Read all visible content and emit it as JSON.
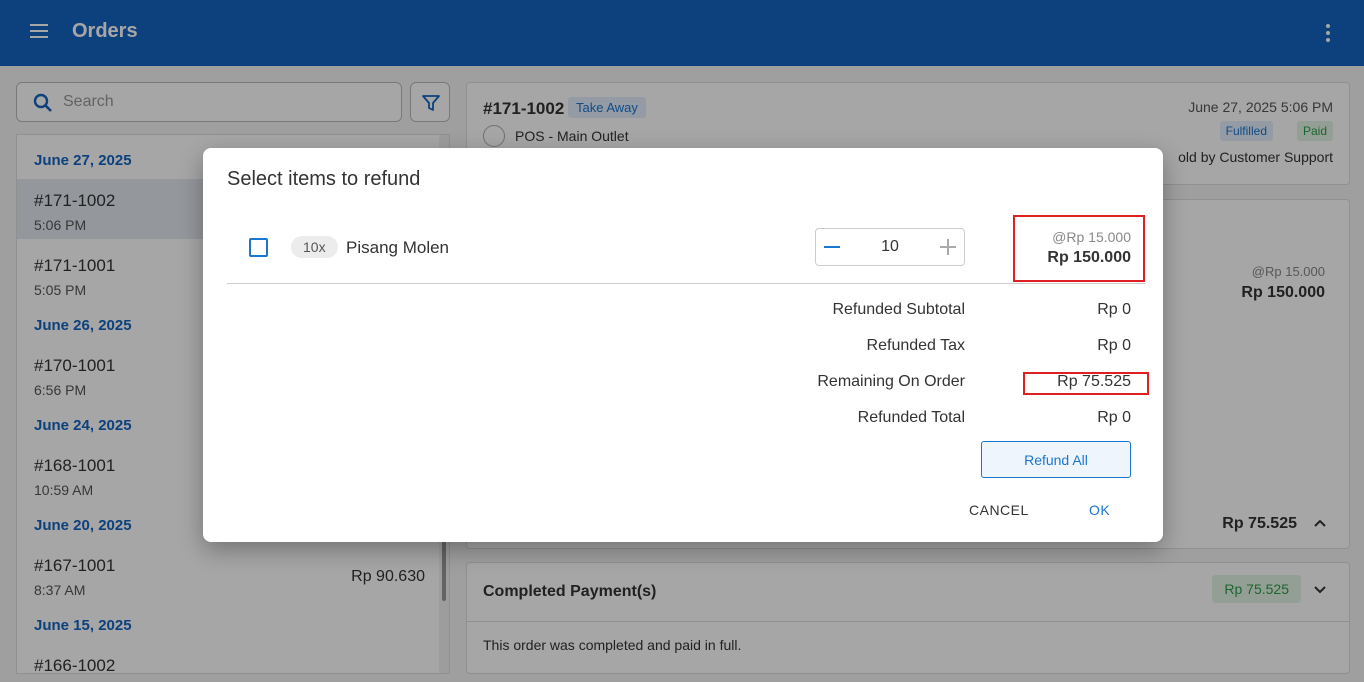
{
  "app": {
    "title": "Orders",
    "menu_icon": "hamburger-menu-icon",
    "more_icon": "more-vert-icon"
  },
  "search": {
    "placeholder": "Search"
  },
  "orders": {
    "groups": [
      {
        "date": "June 27, 2025",
        "items": [
          {
            "num": "#171-1002",
            "time": "5:06 PM",
            "amount": ""
          },
          {
            "num": "#171-1001",
            "time": "5:05 PM",
            "amount": ""
          }
        ]
      },
      {
        "date": "June 26, 2025",
        "items": [
          {
            "num": "#170-1001",
            "time": "6:56 PM",
            "amount": ""
          }
        ]
      },
      {
        "date": "June 24, 2025",
        "items": [
          {
            "num": "#168-1001",
            "time": "10:59 AM",
            "amount": ""
          }
        ]
      },
      {
        "date": "June 20, 2025",
        "items": [
          {
            "num": "#167-1001",
            "time": "8:37 AM",
            "amount": "Rp 90.630"
          }
        ]
      },
      {
        "date": "June 15, 2025",
        "items": [
          {
            "num": "#166-1002",
            "time": "",
            "amount": ""
          }
        ]
      }
    ]
  },
  "detail": {
    "order_id": "#171-1002",
    "order_type": "Take Away",
    "outlet": "POS - Main Outlet",
    "datetime": "June 27, 2025 5:06 PM",
    "badges": [
      "Fulfilled",
      "Paid"
    ],
    "sold_by": "old by Customer Support",
    "item_unit_price": "@Rp 15.000",
    "item_total": "Rp 150.000",
    "order_total": "Rp 75.525",
    "payments_title": "Completed Payment(s)",
    "payments_amount": "Rp 75.525",
    "payments_message": "This order was completed and paid in full."
  },
  "dialog": {
    "title": "Select items to refund",
    "item": {
      "qty_badge": "10x",
      "name": "Pisang Molen",
      "qty": "10",
      "unit_price": "@Rp 15.000",
      "total": "Rp 150.000",
      "checked": false
    },
    "summary": [
      {
        "label": "Refunded Subtotal",
        "value": "Rp 0"
      },
      {
        "label": "Refunded Tax",
        "value": "Rp 0"
      },
      {
        "label": "Remaining On Order",
        "value": "Rp 75.525"
      },
      {
        "label": "Refunded Total",
        "value": "Rp 0"
      }
    ],
    "refund_all": "Refund All",
    "cancel": "CANCEL",
    "ok": "OK"
  },
  "colors": {
    "primary": "#1565c0",
    "accent": "#1976d2",
    "highlight": "#e02020",
    "success": "#2e9b4a"
  }
}
